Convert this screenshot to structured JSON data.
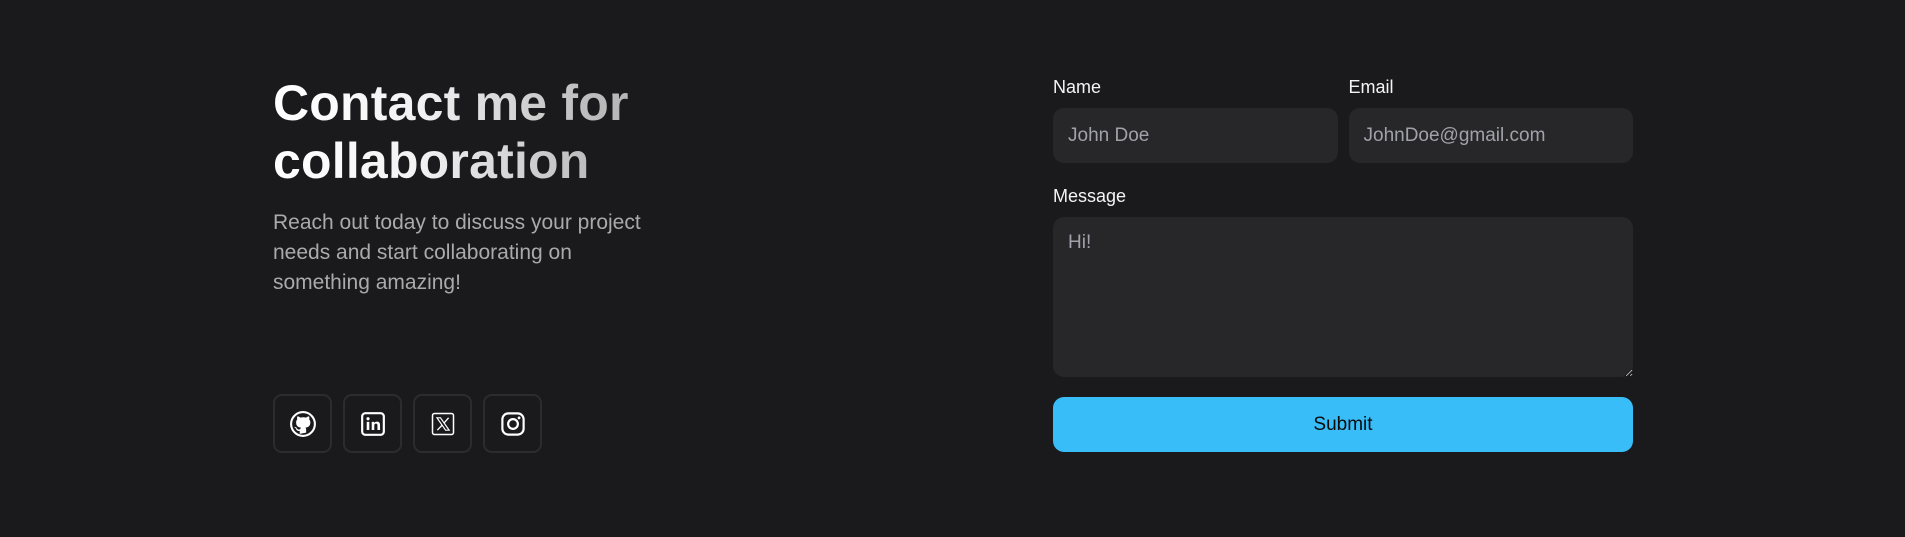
{
  "contact": {
    "heading": "Contact me for collaboration",
    "subtext": "Reach out today to discuss your project needs and start collaborating on something amazing!"
  },
  "socials": [
    {
      "icon": "github-icon"
    },
    {
      "icon": "linkedin-icon"
    },
    {
      "icon": "x-twitter-icon"
    },
    {
      "icon": "instagram-icon"
    }
  ],
  "form": {
    "name_label": "Name",
    "name_placeholder": "John Doe",
    "email_label": "Email",
    "email_placeholder": "JohnDoe@gmail.com",
    "message_label": "Message",
    "message_placeholder": "Hi!",
    "submit_label": "Submit"
  },
  "colors": {
    "background": "#1a1a1c",
    "input_bg": "#27272a",
    "accent": "#38bdf8",
    "muted_text": "#a9a9ae"
  }
}
